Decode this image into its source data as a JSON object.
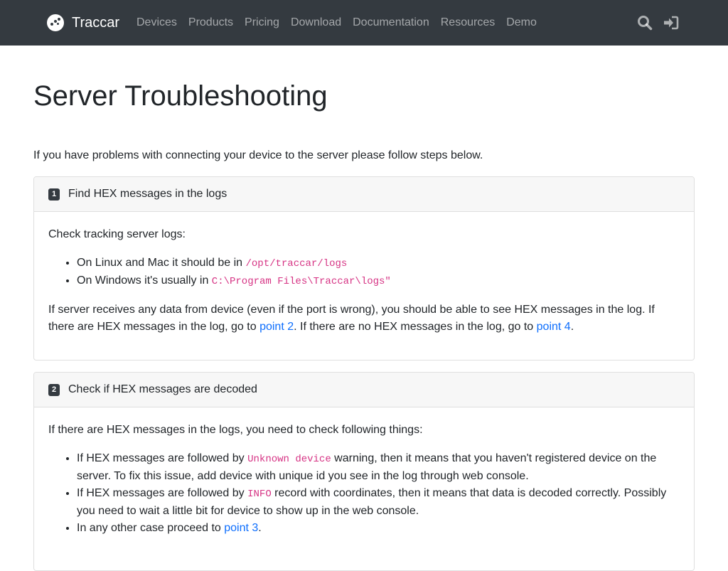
{
  "navbar": {
    "brand": "Traccar",
    "links": [
      "Devices",
      "Products",
      "Pricing",
      "Download",
      "Documentation",
      "Resources",
      "Demo"
    ],
    "icons": [
      "search-icon",
      "sign-in-icon"
    ]
  },
  "page": {
    "title": "Server Troubleshooting",
    "intro": "If you have problems with connecting your device to the server please follow steps below."
  },
  "steps": [
    {
      "number": "1",
      "title": "Find HEX messages in the logs",
      "lead": "Check tracking server logs:",
      "bullet1_prefix": "On Linux and Mac it should be in ",
      "bullet1_code": "/opt/traccar/logs",
      "bullet2_prefix": "On Windows it's usually in ",
      "bullet2_code": "C:\\Program Files\\Traccar\\logs\"",
      "para_a": "If server receives any data from device (even if the port is wrong), you should be able to see HEX messages in the log. If there are HEX messages in the log, go to ",
      "link_a": "point 2",
      "para_b": ". If there are no HEX messages in the log, go to ",
      "link_b": "point 4",
      "para_c": "."
    },
    {
      "number": "2",
      "title": "Check if HEX messages are decoded",
      "lead": "If there are HEX messages in the logs, you need to check following things:",
      "bullet1_prefix": "If HEX messages are followed by ",
      "bullet1_code": "Unknown device",
      "bullet1_suffix": " warning, then it means that you haven't registered device on the server. To fix this issue, add device with unique id you see in the log through web console.",
      "bullet2_prefix": "If HEX messages are followed by ",
      "bullet2_code": "INFO",
      "bullet2_suffix": " record with coordinates, then it means that data is decoded correctly. Possibly you need to wait a little bit for device to show up in the web console.",
      "bullet3_prefix": "In any other case proceed to ",
      "bullet3_link": "point 3",
      "bullet3_suffix": "."
    }
  ],
  "colors": {
    "navbar_bg": "#343a40",
    "link": "#0d6efd",
    "code": "#d63384",
    "card_header_bg": "#f7f7f7"
  }
}
